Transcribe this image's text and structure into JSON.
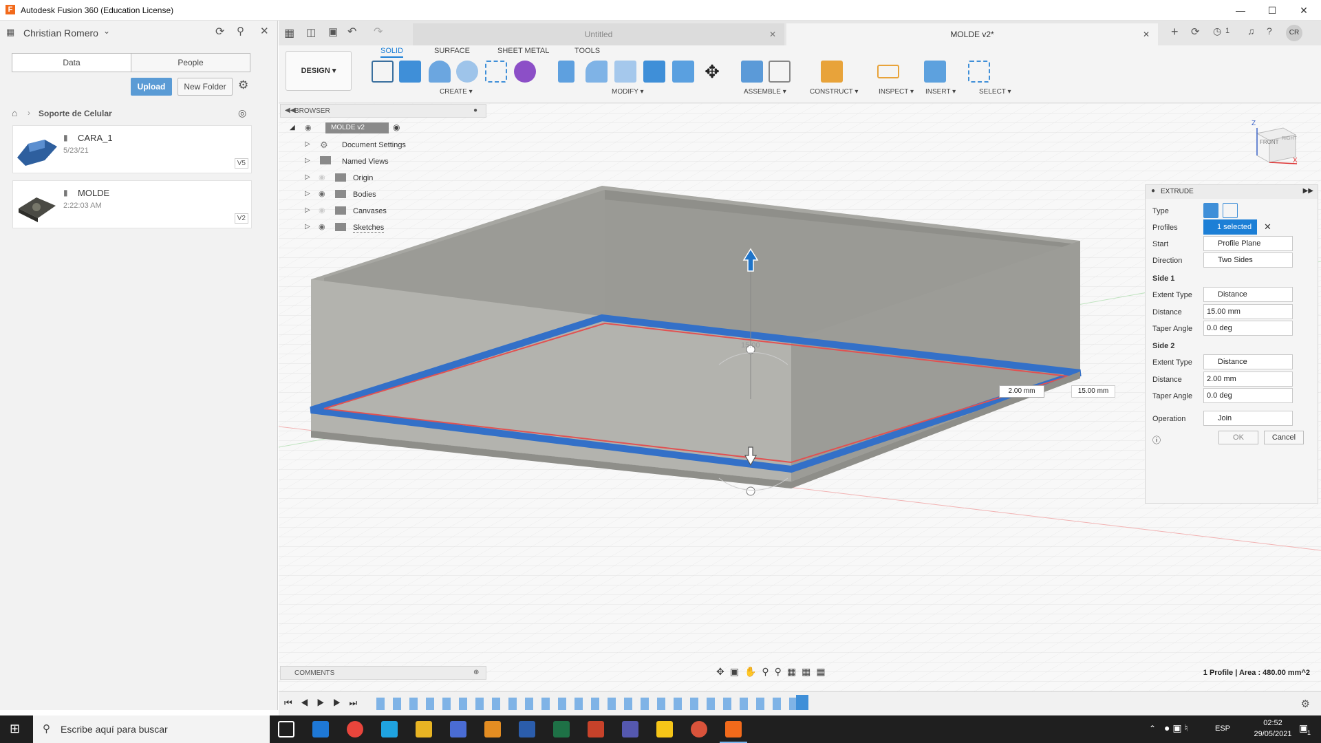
{
  "window": {
    "title": "Autodesk Fusion 360 (Education License)",
    "app_logo": "F"
  },
  "data_panel": {
    "user": "Christian Romero",
    "tabs": [
      "Data",
      "People"
    ],
    "upload_label": "Upload",
    "new_folder_label": "New Folder",
    "breadcrumb": "Soporte de Celular",
    "items": [
      {
        "name": "CARA_1",
        "date": "5/23/21",
        "version": "V5"
      },
      {
        "name": "MOLDE",
        "date": "2:22:03 AM",
        "version": "V2"
      }
    ]
  },
  "doc_tabs": [
    {
      "label": "Untitled",
      "active": false
    },
    {
      "label": "MOLDE v2*",
      "active": true
    }
  ],
  "header_right": {
    "jobs_count": "1",
    "avatar": "CR"
  },
  "toolbar": {
    "workspace": "DESIGN",
    "tabs": [
      "SOLID",
      "SURFACE",
      "SHEET METAL",
      "TOOLS"
    ],
    "groups": [
      "CREATE",
      "MODIFY",
      "ASSEMBLE",
      "CONSTRUCT",
      "INSPECT",
      "INSERT",
      "SELECT"
    ]
  },
  "browser": {
    "title": "BROWSER",
    "root": "MOLDE v2",
    "items": [
      "Document Settings",
      "Named Views",
      "Origin",
      "Bodies",
      "Canvases",
      "Sketches"
    ]
  },
  "viewcube": {
    "face": "FRONT",
    "right": "RIGHT",
    "axis_z": "Z",
    "axis_x": "X"
  },
  "manipulator": {
    "input_side2": "2.00 mm",
    "input_side1": "15.00 mm",
    "ghost": "15.00"
  },
  "extrude": {
    "title": "EXTRUDE",
    "type_label": "Type",
    "profiles_label": "Profiles",
    "profiles_value": "1 selected",
    "start_label": "Start",
    "start_value": "Profile Plane",
    "direction_label": "Direction",
    "direction_value": "Two Sides",
    "side1_label": "Side 1",
    "side1": {
      "extent_label": "Extent Type",
      "extent_value": "Distance",
      "distance_label": "Distance",
      "distance_value": "15.00 mm",
      "taper_label": "Taper Angle",
      "taper_value": "0.0 deg"
    },
    "side2_label": "Side 2",
    "side2": {
      "extent_label": "Extent Type",
      "extent_value": "Distance",
      "distance_label": "Distance",
      "distance_value": "2.00 mm",
      "taper_label": "Taper Angle",
      "taper_value": "0.0 deg"
    },
    "operation_label": "Operation",
    "operation_value": "Join",
    "ok_label": "OK",
    "cancel_label": "Cancel"
  },
  "comments_label": "COMMENTS",
  "status": "1 Profile | Area : 480.00 mm^2",
  "taskbar": {
    "search_placeholder": "Escribe aquí para buscar",
    "lang": "ESP",
    "time": "02:52",
    "date": "29/05/2021",
    "notif": "1"
  }
}
